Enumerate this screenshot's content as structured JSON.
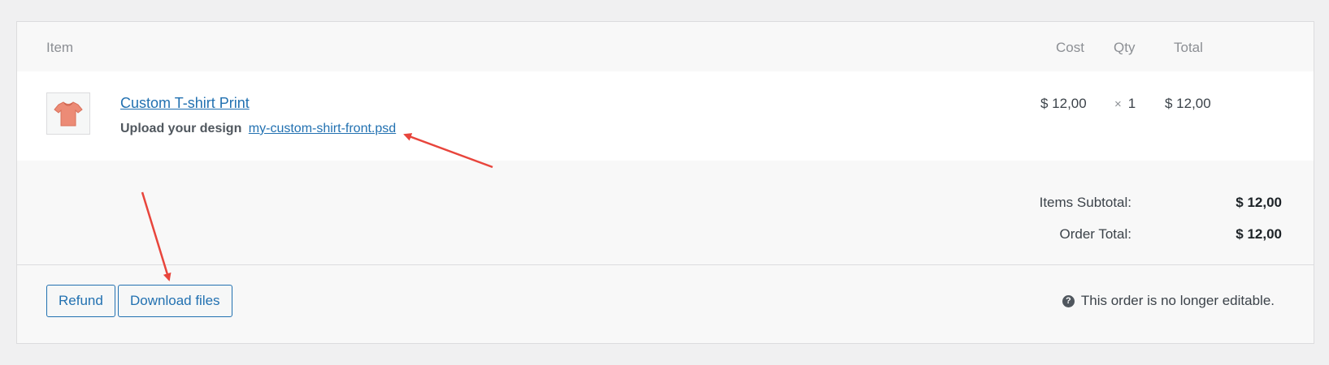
{
  "table": {
    "headers": {
      "item": "Item",
      "cost": "Cost",
      "qty": "Qty",
      "total": "Total"
    }
  },
  "line_item": {
    "name": "Custom T-shirt Print",
    "meta_label": "Upload your design",
    "meta_file": "my-custom-shirt-front.psd",
    "cost": "$ 12,00",
    "qty_symbol": "×",
    "qty": "1",
    "total": "$ 12,00",
    "thumbnail_icon": "tshirt-icon"
  },
  "totals": {
    "subtotal_label": "Items Subtotal:",
    "subtotal_value": "$ 12,00",
    "order_total_label": "Order Total:",
    "order_total_value": "$ 12,00"
  },
  "actions": {
    "refund_label": "Refund",
    "download_label": "Download files",
    "notice_text": "This order is no longer editable.",
    "notice_icon": "help-icon"
  },
  "colors": {
    "accent": "#2271b1",
    "annotation_arrow": "#e8453c"
  }
}
